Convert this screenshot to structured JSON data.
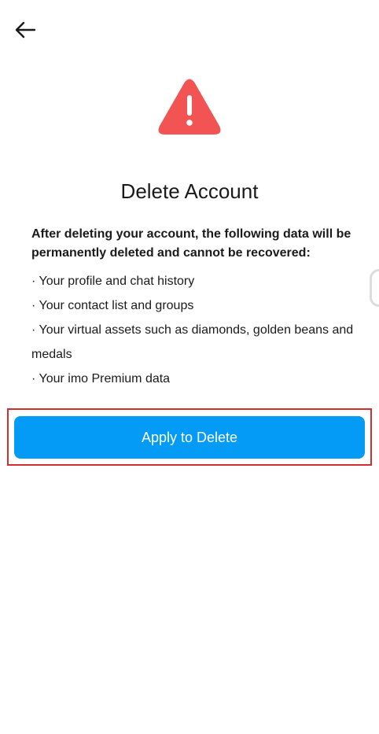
{
  "header": {
    "back_icon": "arrow-left-icon"
  },
  "warning": {
    "icon": "warning-triangle-icon",
    "color": "#f25454"
  },
  "title": "Delete Account",
  "intro": "After deleting your account, the following data will be permanently deleted and cannot be recovered:",
  "items": [
    "· Your profile and chat history",
    "· Your contact list and groups",
    "· Your virtual assets such as diamonds, golden beans and medals",
    "· Your imo Premium data"
  ],
  "action": {
    "label": "Apply to Delete",
    "color": "#039bf6",
    "highlight_color": "#d32f2f"
  }
}
